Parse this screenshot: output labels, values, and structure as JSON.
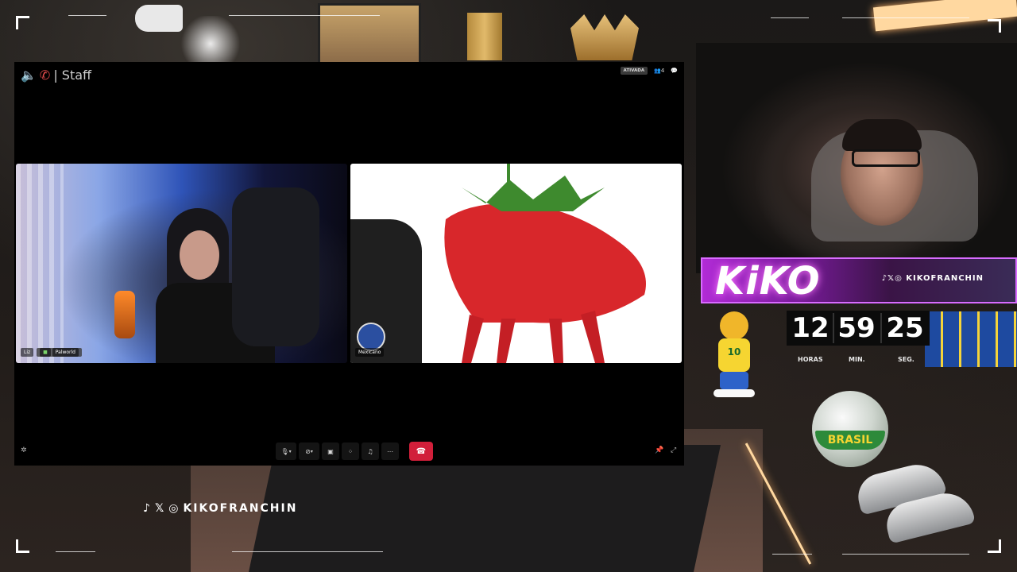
{
  "call": {
    "channel": "| Staff",
    "status_badge": "ATIVADA",
    "participant_count": "4",
    "participants": [
      {
        "name": "Liz",
        "game": "Palworld"
      },
      {
        "name": "Mexicano",
        "game": ""
      }
    ],
    "controls": [
      "mic-icon",
      "chevron-down-icon",
      "camera-off-icon",
      "chevron-down-icon",
      "screen-share-icon",
      "activities-icon",
      "soundboard-icon",
      "more-icon",
      "hang-up-icon"
    ]
  },
  "overlay": {
    "streamer_name": "KiKO",
    "social_handle": "KIKOFRANCHIN",
    "timer": {
      "hours": "12",
      "minutes": "59",
      "seconds": "25",
      "hours_label": "HORAS",
      "minutes_label": "MIN.",
      "seconds_label": "SEG."
    },
    "mascot_number": "10",
    "ball_text": "BRASIL"
  },
  "colors": {
    "banner_purple": "#b12bd6",
    "hangup_red": "#d11f3a",
    "call_bg": "#000000"
  }
}
